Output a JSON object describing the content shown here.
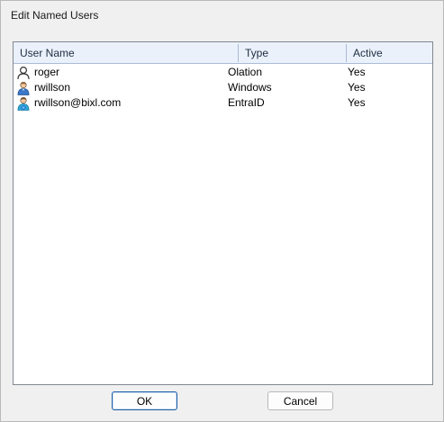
{
  "window": {
    "title": "Edit Named Users"
  },
  "table": {
    "columns": [
      "User Name",
      "Type",
      "Active"
    ],
    "rows": [
      {
        "name": "roger",
        "type": "Olation",
        "active": "Yes",
        "icon": "user-outline-icon"
      },
      {
        "name": "rwillson",
        "type": "Windows",
        "active": "Yes",
        "icon": "windows-user-icon"
      },
      {
        "name": "rwillson@bixl.com",
        "type": "EntraID",
        "active": "Yes",
        "icon": "entra-user-icon"
      }
    ]
  },
  "buttons": {
    "ok_label": "OK",
    "cancel_label": "Cancel"
  },
  "colors": {
    "header_bg": "#eaf1fb",
    "accent_border": "#1f5fa8",
    "window_bg": "#f0f0f0"
  }
}
